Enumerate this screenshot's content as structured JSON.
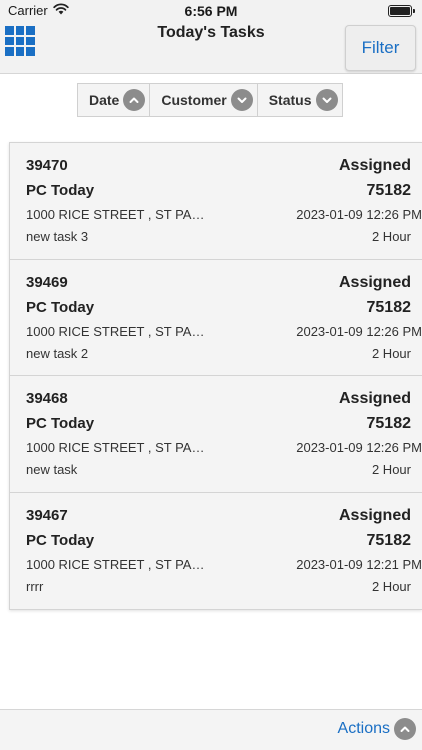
{
  "status_bar": {
    "carrier": "Carrier",
    "time": "6:56 PM"
  },
  "header": {
    "title": "Today's Tasks",
    "filter_label": "Filter"
  },
  "sort": [
    {
      "label": "Date",
      "direction": "up"
    },
    {
      "label": "Customer",
      "direction": "down"
    },
    {
      "label": "Status",
      "direction": "down"
    }
  ],
  "tasks": [
    {
      "id": "39470",
      "status": "Assigned",
      "customer": "PC Today",
      "ref": "75182",
      "address": "1000 RICE STREET , ST PA…",
      "datetime": "2023-01-09 12:26 PM",
      "name": "new task 3",
      "duration": "2 Hour"
    },
    {
      "id": "39469",
      "status": "Assigned",
      "customer": "PC Today",
      "ref": "75182",
      "address": "1000 RICE STREET , ST PA…",
      "datetime": "2023-01-09 12:26 PM",
      "name": "new task 2",
      "duration": "2 Hour"
    },
    {
      "id": "39468",
      "status": "Assigned",
      "customer": "PC Today",
      "ref": "75182",
      "address": "1000 RICE STREET , ST PA…",
      "datetime": "2023-01-09 12:26 PM",
      "name": "new task",
      "duration": "2 Hour"
    },
    {
      "id": "39467",
      "status": "Assigned",
      "customer": "PC Today",
      "ref": "75182",
      "address": "1000 RICE STREET , ST PA…",
      "datetime": "2023-01-09 12:21 PM",
      "name": "rrrr",
      "duration": "2 Hour"
    }
  ],
  "footer": {
    "actions_label": "Actions"
  },
  "colors": {
    "accent": "#1a6fc4",
    "chevron": "#8c8c8c",
    "card_bg": "#f4f4f4"
  },
  "icons": {
    "menu": "grid-icon",
    "wifi": "wifi-icon",
    "battery": "battery-icon",
    "chevron_up": "chevron-up-icon",
    "chevron_down": "chevron-down-icon"
  }
}
